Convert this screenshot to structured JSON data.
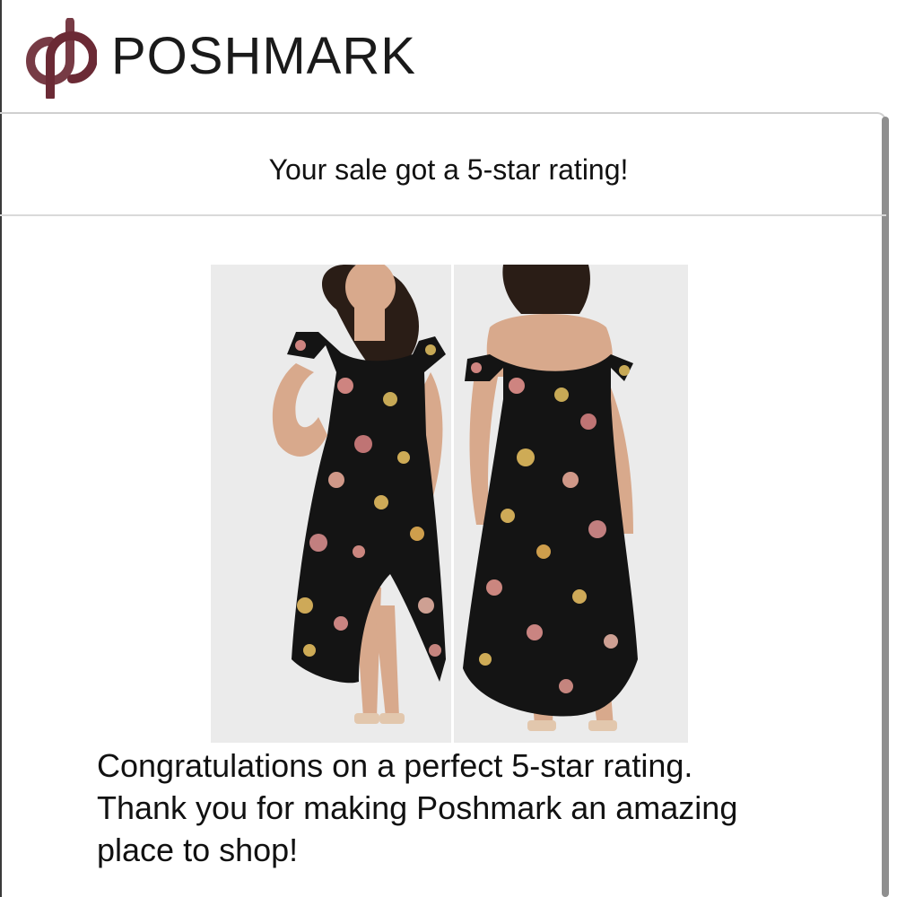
{
  "header": {
    "brand": "POSHMARK",
    "logo_icon": "poshmark-logo-icon",
    "brand_color": "#6b2a35"
  },
  "notification": {
    "title": "Your sale got a 5-star rating!"
  },
  "product": {
    "images": [
      {
        "view": "front"
      },
      {
        "view": "back"
      }
    ]
  },
  "message": {
    "lines": [
      "Congratulations on a perfect 5-star rating.",
      "Thank you for making Poshmark an amazing",
      "place to shop!"
    ]
  }
}
